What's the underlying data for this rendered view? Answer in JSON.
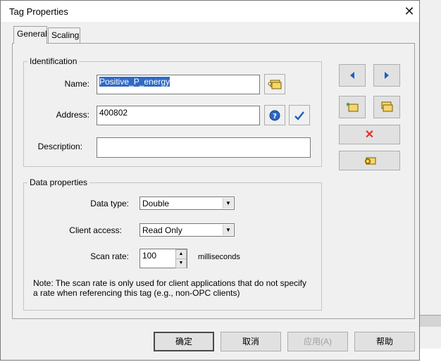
{
  "window": {
    "title": "Tag Properties",
    "close_glyph": "✕"
  },
  "tabs": [
    {
      "label": "General",
      "active": true
    },
    {
      "label": "Scaling",
      "active": false
    }
  ],
  "identification": {
    "group_label": "Identification",
    "name_label": "Name:",
    "name_value": "Positive_P_energy",
    "address_label": "Address:",
    "address_value": "400802",
    "description_label": "Description:",
    "description_value": ""
  },
  "data_properties": {
    "group_label": "Data properties",
    "data_type_label": "Data type:",
    "data_type_value": "Double",
    "client_access_label": "Client access:",
    "client_access_value": "Read Only",
    "scan_rate_label": "Scan rate:",
    "scan_rate_value": "100",
    "scan_rate_unit": "milliseconds",
    "note": "Note: The scan rate is only used for client applications that do not specify a rate when referencing this tag (e.g., non-OPC clients)"
  },
  "side_buttons": {
    "prev_icon": "arrow-left-icon",
    "next_icon": "arrow-right-icon",
    "delete_glyph": "✕",
    "colors": {
      "accent_blue": "#1f5fbf",
      "delete_red": "#e03030",
      "tag_yellow": "#f5d76e"
    }
  },
  "footer": {
    "ok": "确定",
    "cancel": "取消",
    "apply": "应用(A)",
    "help": "帮助"
  }
}
